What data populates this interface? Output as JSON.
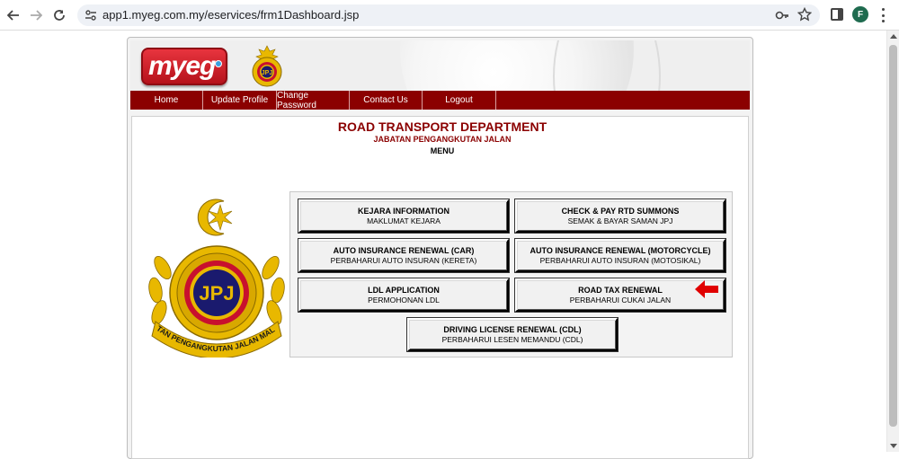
{
  "browser": {
    "url": "app1.myeg.com.my/eservices/frm1Dashboard.jsp",
    "profile_initial": "F",
    "icons": [
      "back-icon",
      "forward-icon",
      "reload-icon",
      "site-info-icon",
      "key-icon",
      "star-icon",
      "side-panel-icon",
      "kebab-menu-icon"
    ]
  },
  "site": {
    "logo_text": "myeg",
    "nav": [
      {
        "label": "Home"
      },
      {
        "label": "Update Profile"
      },
      {
        "label": "Change Password"
      },
      {
        "label": "Contact Us"
      },
      {
        "label": "Logout"
      }
    ],
    "title": "ROAD TRANSPORT DEPARTMENT",
    "subtitle": "JABATAN PENGANGKUTAN JALAN",
    "menu_label": "MENU",
    "crest_text": "JPJ",
    "crest_ring_text": "JABATAN PENGANGKUTAN JALAN MALAYSIA",
    "buttons": [
      {
        "title": "KEJARA INFORMATION",
        "subtitle": "MAKLUMAT KEJARA"
      },
      {
        "title": "CHECK & PAY RTD SUMMONS",
        "subtitle": "SEMAK & BAYAR SAMAN JPJ"
      },
      {
        "title": "AUTO INSURANCE RENEWAL (CAR)",
        "subtitle": "PERBAHARUI AUTO INSURAN (KERETA)"
      },
      {
        "title": "AUTO INSURANCE RENEWAL (MOTORCYCLE)",
        "subtitle": "PERBAHARUI AUTO INSURAN (MOTOSIKAL)"
      },
      {
        "title": "LDL APPLICATION",
        "subtitle": "PERMOHONAN LDL"
      },
      {
        "title": "ROAD TAX RENEWAL",
        "subtitle": "PERBAHARUI CUKAI JALAN"
      },
      {
        "title": "DRIVING LICENSE RENEWAL (CDL)",
        "subtitle": "PERBAHARUI LESEN MEMANDU (CDL)"
      }
    ]
  },
  "colors": {
    "brand_red": "#8b0000",
    "logo_red": "#d42a33",
    "crest_gold": "#e8b800",
    "arrow_red": "#e00000"
  }
}
